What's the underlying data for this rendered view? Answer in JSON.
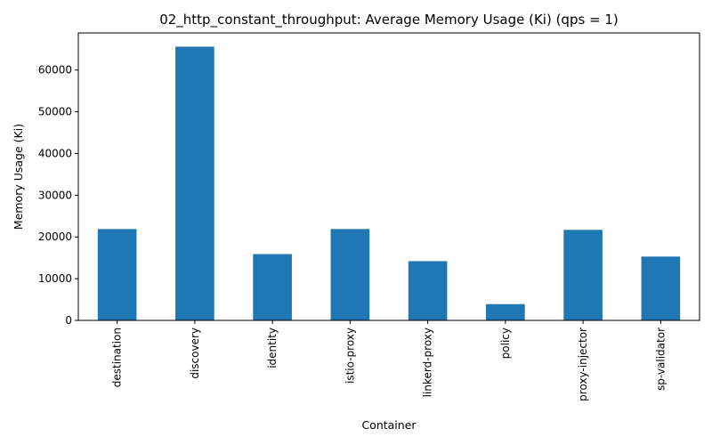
{
  "chart_data": {
    "type": "bar",
    "title": "02_http_constant_throughput: Average Memory Usage (Ki) (qps = 1)",
    "xlabel": "Container",
    "ylabel": "Memory Usage (Ki)",
    "categories": [
      "destination",
      "discovery",
      "identity",
      "istio-proxy",
      "linkerd-proxy",
      "policy",
      "proxy-injector",
      "sp-validator"
    ],
    "values": [
      21900,
      65600,
      15900,
      21900,
      14200,
      3900,
      21700,
      15300
    ],
    "ylim": [
      0,
      68900
    ],
    "yticks": [
      0,
      10000,
      20000,
      30000,
      40000,
      50000,
      60000
    ],
    "ytick_labels": [
      "0",
      "10000",
      "20000",
      "30000",
      "40000",
      "50000",
      "60000"
    ],
    "bar_color": "#1f77b4",
    "grid": false,
    "legend": "none"
  }
}
